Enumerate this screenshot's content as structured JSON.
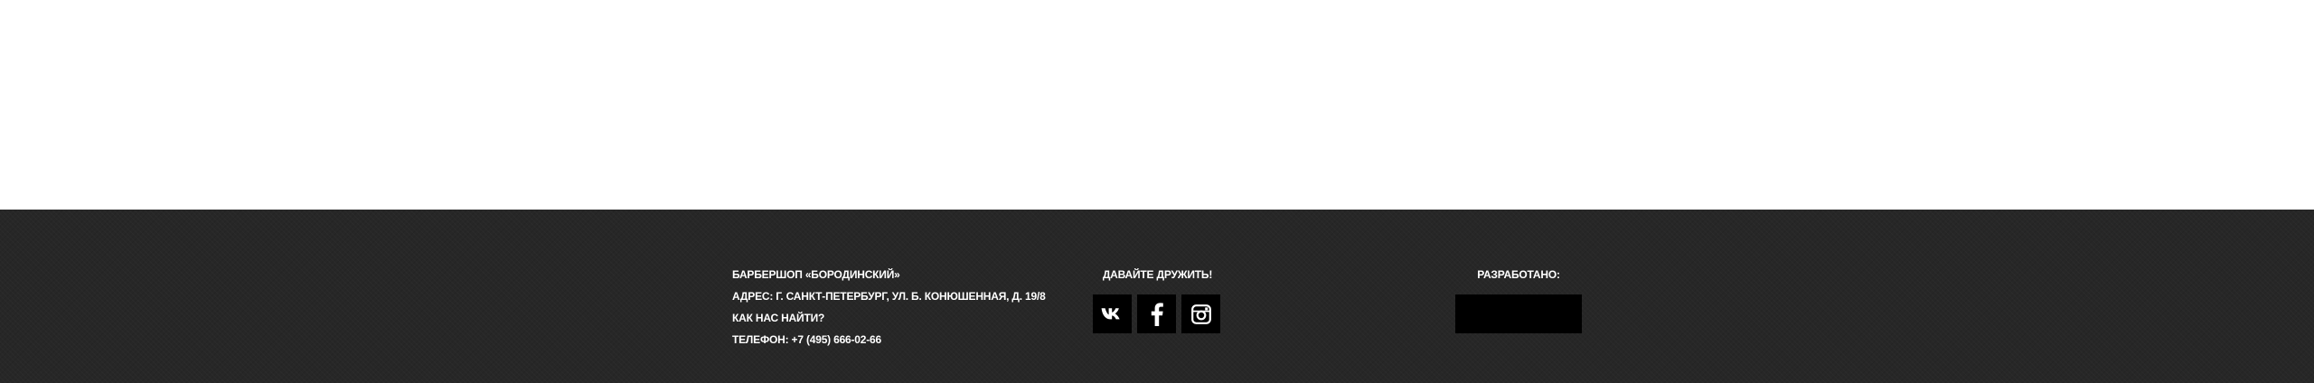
{
  "footer": {
    "info": {
      "name": "БАРБЕРШОП «БОРОДИНСКИЙ»",
      "address": "АДРЕС: Г. САНКТ-ПЕТЕРБУРГ, УЛ. Б. КОНЮШЕННАЯ, Д. 19/8",
      "directions_link": "КАК НАС НАЙТИ?",
      "phone": "ТЕЛЕФОН: +7 (495) 666-02-66"
    },
    "social": {
      "title": "ДАВАЙТЕ ДРУЖИТЬ!",
      "icons": [
        "vk-icon",
        "facebook-icon",
        "instagram-icon"
      ]
    },
    "developer": {
      "title": "РАЗРАБОТАНО:"
    }
  },
  "colors": {
    "footer_background": "#272727",
    "text": "#ffffff",
    "button_background": "#000000"
  }
}
